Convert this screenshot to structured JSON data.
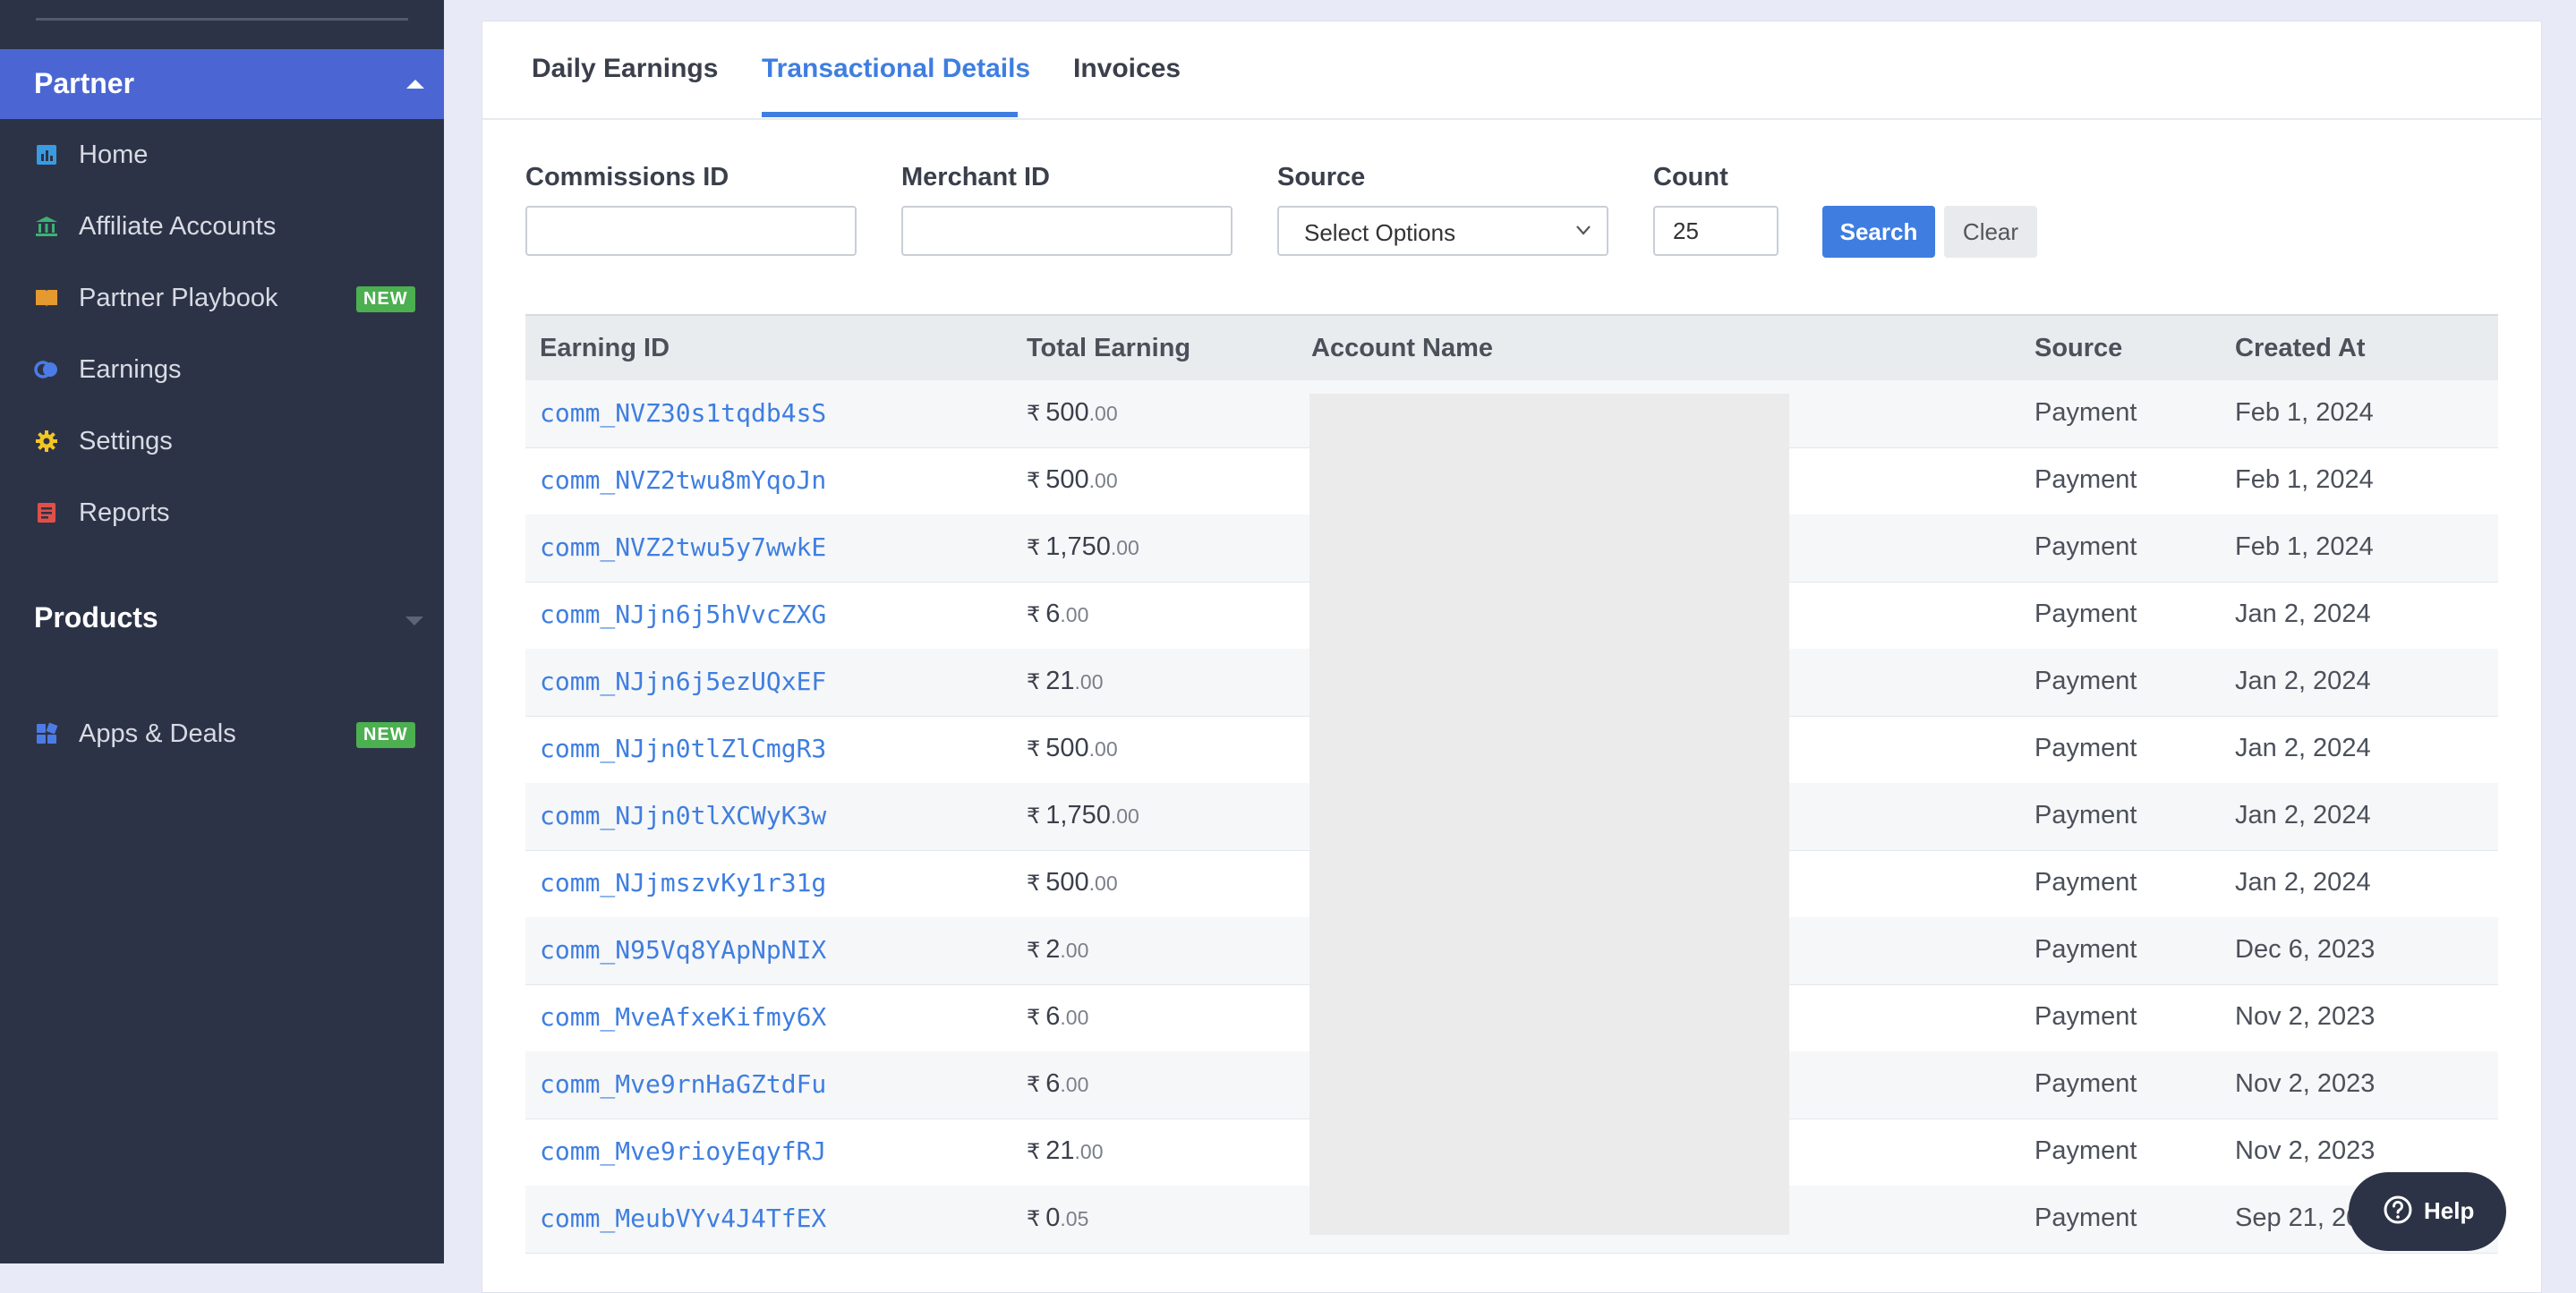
{
  "sidebar": {
    "partner_title": "Partner",
    "items": [
      {
        "label": "Home",
        "icon": "home-chart-icon",
        "color": "#3a9be0"
      },
      {
        "label": "Affiliate Accounts",
        "icon": "bank-icon",
        "color": "#3bb273"
      },
      {
        "label": "Partner Playbook",
        "icon": "book-icon",
        "color": "#e59a2f",
        "badge": "NEW"
      },
      {
        "label": "Earnings",
        "icon": "coins-icon",
        "color": "#4b7be5"
      },
      {
        "label": "Settings",
        "icon": "gear-icon",
        "color": "#f3c623"
      },
      {
        "label": "Reports",
        "icon": "report-icon",
        "color": "#e0504a"
      }
    ],
    "products_title": "Products",
    "apps": {
      "label": "Apps & Deals",
      "icon": "apps-icon",
      "color": "#4b7be5",
      "badge": "NEW"
    }
  },
  "tabs": [
    "Daily Earnings",
    "Transactional Details",
    "Invoices"
  ],
  "active_tab": "Transactional Details",
  "filters": {
    "commissions_label": "Commissions ID",
    "commissions_value": "",
    "merchant_label": "Merchant ID",
    "merchant_value": "",
    "source_label": "Source",
    "source_value": "Select Options",
    "count_label": "Count",
    "count_value": "25",
    "search_label": "Search",
    "clear_label": "Clear"
  },
  "table": {
    "headers": [
      "Earning ID",
      "Total Earning",
      "Account Name",
      "Source",
      "Created At"
    ],
    "currency": "₹",
    "rows": [
      {
        "id": "comm_NVZ30s1tqdb4sS",
        "amount": "500",
        "dec": ".00",
        "source": "Payment",
        "date": "Feb 1, 2024"
      },
      {
        "id": "comm_NVZ2twu8mYqoJn",
        "amount": "500",
        "dec": ".00",
        "source": "Payment",
        "date": "Feb 1, 2024"
      },
      {
        "id": "comm_NVZ2twu5y7wwkE",
        "amount": "1,750",
        "dec": ".00",
        "source": "Payment",
        "date": "Feb 1, 2024"
      },
      {
        "id": "comm_NJjn6j5hVvcZXG",
        "amount": "6",
        "dec": ".00",
        "source": "Payment",
        "date": "Jan 2, 2024"
      },
      {
        "id": "comm_NJjn6j5ezUQxEF",
        "amount": "21",
        "dec": ".00",
        "source": "Payment",
        "date": "Jan 2, 2024"
      },
      {
        "id": "comm_NJjn0tlZlCmgR3",
        "amount": "500",
        "dec": ".00",
        "source": "Payment",
        "date": "Jan 2, 2024"
      },
      {
        "id": "comm_NJjn0tlXCWyK3w",
        "amount": "1,750",
        "dec": ".00",
        "source": "Payment",
        "date": "Jan 2, 2024"
      },
      {
        "id": "comm_NJjmszvKy1r31g",
        "amount": "500",
        "dec": ".00",
        "source": "Payment",
        "date": "Jan 2, 2024"
      },
      {
        "id": "comm_N95Vq8YApNpNIX",
        "amount": "2",
        "dec": ".00",
        "source": "Payment",
        "date": "Dec 6, 2023"
      },
      {
        "id": "comm_MveAfxeKifmy6X",
        "amount": "6",
        "dec": ".00",
        "source": "Payment",
        "date": "Nov 2, 2023"
      },
      {
        "id": "comm_Mve9rnHaGZtdFu",
        "amount": "6",
        "dec": ".00",
        "source": "Payment",
        "date": "Nov 2, 2023"
      },
      {
        "id": "comm_Mve9rioyEqyfRJ",
        "amount": "21",
        "dec": ".00",
        "source": "Payment",
        "date": "Nov 2, 2023"
      },
      {
        "id": "comm_MeubVYv4J4TfEX",
        "amount": "0",
        "dec": ".05",
        "source": "Payment",
        "date": "Sep 21, 20"
      }
    ]
  },
  "help_label": "Help"
}
